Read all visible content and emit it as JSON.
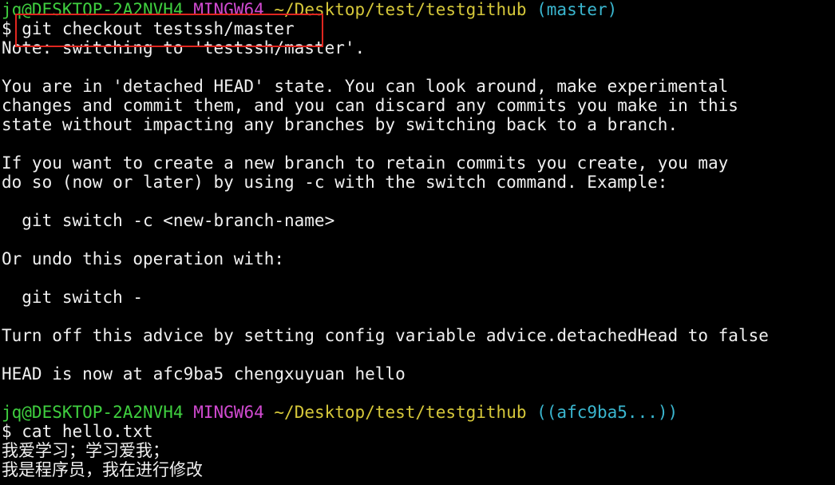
{
  "prompt1": {
    "userhost": "jq@DESKTOP-2A2NVH4",
    "env": "MINGW64",
    "path": "~/Desktop/test/testgithub",
    "branch": "(master)"
  },
  "cmd1": "$ git checkout testssh/master",
  "output": [
    "Note: switching to 'testssh/master'.",
    "",
    "You are in 'detached HEAD' state. You can look around, make experimental",
    "changes and commit them, and you can discard any commits you make in this",
    "state without impacting any branches by switching back to a branch.",
    "",
    "If you want to create a new branch to retain commits you create, you may",
    "do so (now or later) by using -c with the switch command. Example:",
    "",
    "  git switch -c <new-branch-name>",
    "",
    "Or undo this operation with:",
    "",
    "  git switch -",
    "",
    "Turn off this advice by setting config variable advice.detachedHead to false",
    "",
    "HEAD is now at afc9ba5 chengxuyuan hello",
    ""
  ],
  "prompt2": {
    "userhost": "jq@DESKTOP-2A2NVH4",
    "env": "MINGW64",
    "path": "~/Desktop/test/testgithub",
    "branch": "((afc9ba5...))"
  },
  "cmd2": "$ cat hello.txt",
  "file_lines": [
    "我爱学习；学习爱我；",
    "我是程序员，我在进行修改"
  ],
  "colors": {
    "background": "#000000",
    "userhost": "#3fcf3f",
    "env": "#d14ad1",
    "path": "#d6c83a",
    "branch": "#3ab6cf",
    "highlight_box": "#e0261f"
  }
}
